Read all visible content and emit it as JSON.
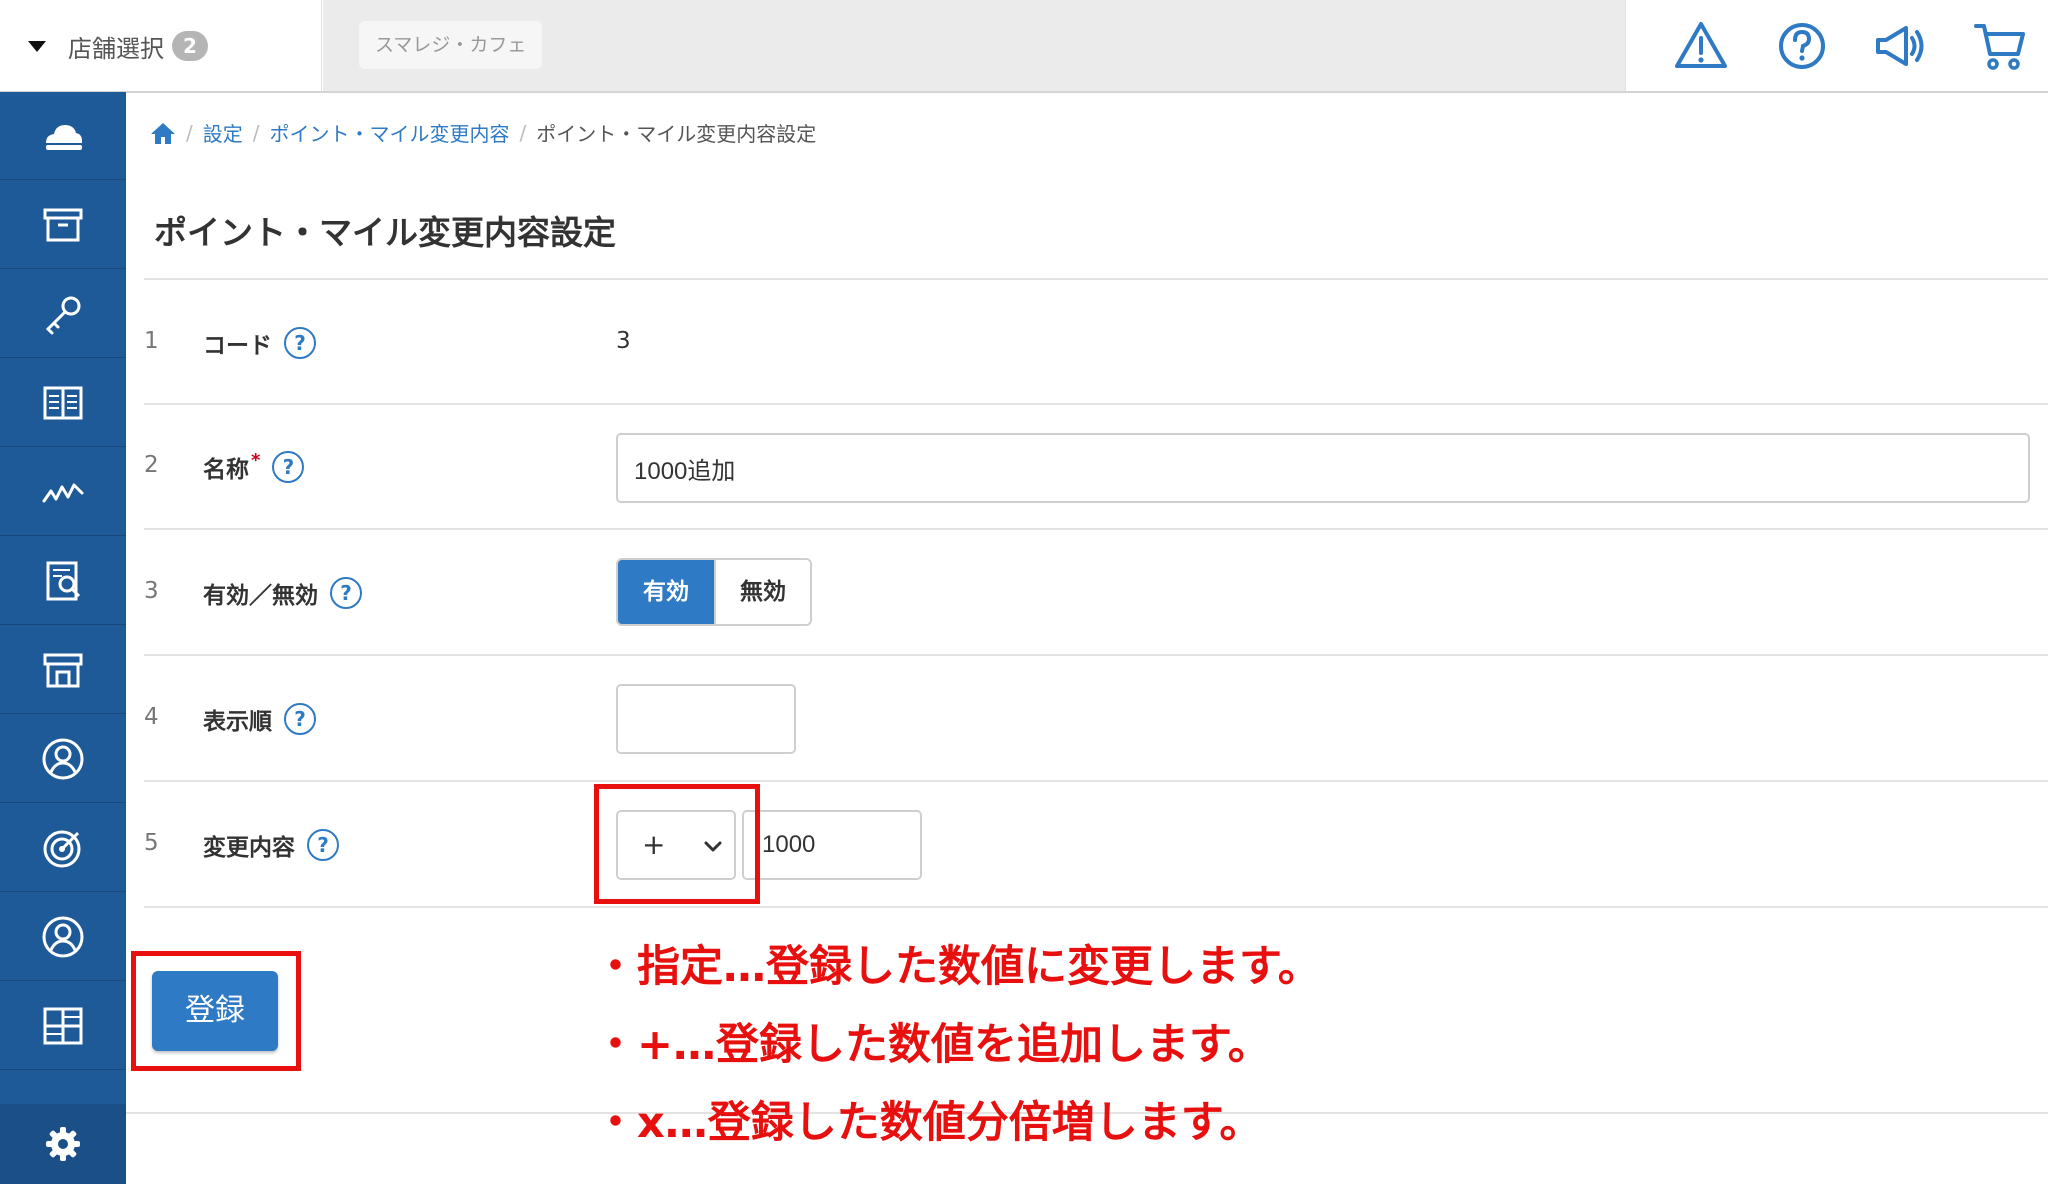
{
  "topbar": {
    "store_select_label": "店舗選択",
    "store_count": "2",
    "store_name": "スマレジ・カフェ",
    "icons": [
      "alert-icon",
      "help-icon",
      "megaphone-icon",
      "cart-icon"
    ]
  },
  "sidebar": {
    "items": [
      "cloud-icon",
      "archive-icon",
      "key-icon",
      "book-icon",
      "chart-icon",
      "report-icon",
      "store-icon",
      "customer-icon",
      "target-icon",
      "user-icon",
      "grid-icon"
    ],
    "settings_icon": "gear-icon"
  },
  "breadcrumb": {
    "home_icon": "home-icon",
    "items": [
      "設定",
      "ポイント・マイル変更内容"
    ],
    "current": "ポイント・マイル変更内容設定"
  },
  "page": {
    "title": "ポイント・マイル変更内容設定"
  },
  "form": {
    "rows": [
      {
        "num": "1",
        "label": "コード",
        "value": "3"
      },
      {
        "num": "2",
        "label": "名称",
        "required_mark": "*",
        "value": "1000追加"
      },
      {
        "num": "3",
        "label": "有効／無効",
        "options": [
          "有効",
          "無効"
        ],
        "selected": "有効"
      },
      {
        "num": "4",
        "label": "表示順",
        "value": ""
      },
      {
        "num": "5",
        "label": "変更内容",
        "operator": "+",
        "value": "1000"
      }
    ],
    "help_mark": "?",
    "submit_label": "登録"
  },
  "annotations": [
    "・指定…登録した数値に変更します。",
    "・+…登録した数値を追加します。",
    "・x…登録した数値分倍増します。"
  ],
  "colors": {
    "sidebar": "#1f5a98",
    "accent": "#2f7ac4",
    "annotation": "#e8100f"
  }
}
